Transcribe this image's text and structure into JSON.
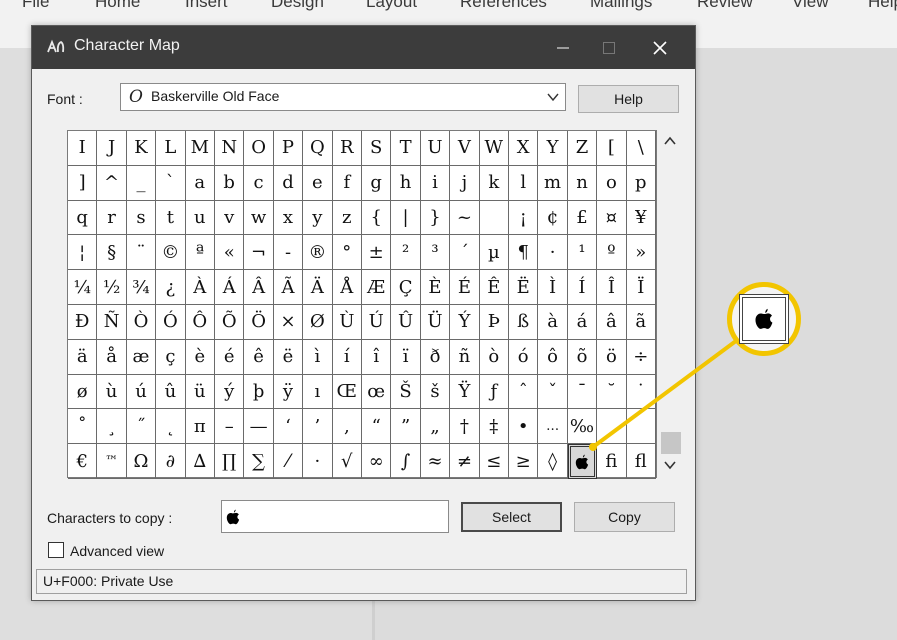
{
  "ribbon": {
    "tabs": [
      "File",
      "Home",
      "Insert",
      "Design",
      "Layout",
      "References",
      "Mailings",
      "Review",
      "View",
      "Help"
    ]
  },
  "dialog": {
    "title": "Character Map",
    "font_label": "Font :",
    "font_value": "Baskerville Old Face",
    "help_label": "Help",
    "chars_to_copy_label": "Characters to copy :",
    "chars_to_copy_value": "",
    "select_label": "Select",
    "copy_label": "Copy",
    "advanced_view_label": "Advanced view",
    "advanced_view_checked": false,
    "status_text": "U+F000: Private Use"
  },
  "grid": {
    "columns": 20,
    "selected_row": 9,
    "selected_col": 17,
    "rows": [
      [
        "I",
        "J",
        "K",
        "L",
        "M",
        "N",
        "O",
        "P",
        "Q",
        "R",
        "S",
        "T",
        "U",
        "V",
        "W",
        "X",
        "Y",
        "Z",
        "[",
        "\\"
      ],
      [
        "]",
        "^",
        "_",
        "`",
        "a",
        "b",
        "c",
        "d",
        "e",
        "f",
        "g",
        "h",
        "i",
        "j",
        "k",
        "l",
        "m",
        "n",
        "o",
        "p"
      ],
      [
        "q",
        "r",
        "s",
        "t",
        "u",
        "v",
        "w",
        "x",
        "y",
        "z",
        "{",
        "|",
        "}",
        "~",
        "",
        "¡",
        "¢",
        "£",
        "¤",
        "¥"
      ],
      [
        "¦",
        "§",
        "¨",
        "©",
        "ª",
        "«",
        "¬",
        "-",
        "®",
        "°",
        "±",
        "²",
        "³",
        "´",
        "µ",
        "¶",
        "·",
        "¹",
        "º",
        "»"
      ],
      [
        "¼",
        "½",
        "¾",
        "¿",
        "À",
        "Á",
        "Â",
        "Ã",
        "Ä",
        "Å",
        "Æ",
        "Ç",
        "È",
        "É",
        "Ê",
        "Ë",
        "Ì",
        "Í",
        "Î",
        "Ï"
      ],
      [
        "Ð",
        "Ñ",
        "Ò",
        "Ó",
        "Ô",
        "Õ",
        "Ö",
        "×",
        "Ø",
        "Ù",
        "Ú",
        "Û",
        "Ü",
        "Ý",
        "Þ",
        "ß",
        "à",
        "á",
        "â",
        "ã"
      ],
      [
        "ä",
        "å",
        "æ",
        "ç",
        "è",
        "é",
        "ê",
        "ë",
        "ì",
        "í",
        "î",
        "ï",
        "ð",
        "ñ",
        "ò",
        "ó",
        "ô",
        "õ",
        "ö",
        "÷"
      ],
      [
        "ø",
        "ù",
        "ú",
        "û",
        "ü",
        "ý",
        "þ",
        "ÿ",
        "ı",
        "Œ",
        "œ",
        "Š",
        "š",
        "Ÿ",
        "ƒ",
        "ˆ",
        "ˇ",
        "¯",
        "˘",
        "˙"
      ],
      [
        "˚",
        "¸",
        "˝",
        "˛",
        "π",
        "–",
        "—",
        "‘",
        "’",
        "‚",
        "“",
        "”",
        "„",
        "†",
        "‡",
        "•",
        "…",
        "‰",
        "",
        ""
      ],
      [
        "€",
        "™",
        "Ω",
        "∂",
        "∆",
        "∏",
        "∑",
        "⁄",
        "·",
        "√",
        "∞",
        "∫",
        "≈",
        "≠",
        "≤",
        "≥",
        "◊",
        "",
        "ﬁ",
        "ﬂ"
      ]
    ]
  },
  "icons": {
    "app": "character-map-icon",
    "font_type": "opentype-font-icon",
    "dropdown": "chevron-down-icon",
    "scroll_up": "scroll-up-icon",
    "scroll_down": "scroll-down-icon",
    "apple": "apple-logo-icon"
  },
  "colors": {
    "titlebar": "#3c3c3c",
    "callout": "#f2c500"
  }
}
